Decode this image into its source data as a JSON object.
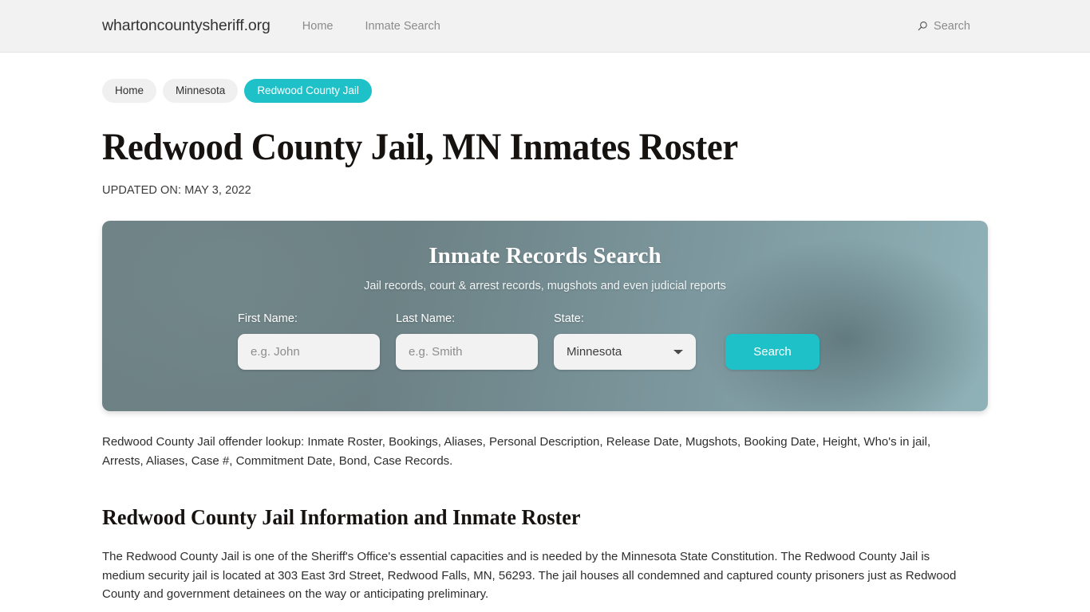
{
  "header": {
    "brand": "whartoncountysheriff.org",
    "nav": [
      {
        "label": "Home"
      },
      {
        "label": "Inmate Search"
      }
    ],
    "search": {
      "icon": "search-icon",
      "label": "Search"
    }
  },
  "breadcrumb": [
    {
      "label": "Home",
      "current": false
    },
    {
      "label": "Minnesota",
      "current": false
    },
    {
      "label": "Redwood County Jail",
      "current": true
    }
  ],
  "main": {
    "page_title": "Redwood County Jail, MN Inmates Roster",
    "updated_on": "UPDATED ON: MAY 3, 2022",
    "lookup_text": "Redwood County Jail offender lookup: Inmate Roster, Bookings, Aliases, Personal Description, Release Date, Mugshots, Booking Date, Height, Who's in jail, Arrests, Aliases, Case #, Commitment Date, Bond, Case Records.",
    "section_title": "Redwood County Jail Information and Inmate Roster",
    "section_body": "The Redwood County Jail is one of the Sheriff's Office's essential capacities and is needed by the Minnesota State Constitution. The Redwood County Jail is medium security jail is located at 303 East 3rd Street, Redwood Falls, MN, 56293. The jail houses all condemned and captured county prisoners just as Redwood County and government detainees on the way or anticipating preliminary."
  },
  "search_panel": {
    "title": "Inmate Records Search",
    "subtitle": "Jail records, court & arrest records, mugshots and even judicial reports",
    "first_name": {
      "label": "First Name:",
      "placeholder": "e.g. John",
      "value": ""
    },
    "last_name": {
      "label": "Last Name:",
      "placeholder": "e.g. Smith",
      "value": ""
    },
    "state": {
      "label": "State:",
      "selected": "Minnesota",
      "options": [
        "Minnesota"
      ]
    },
    "submit_label": "Search"
  },
  "colors": {
    "accent_teal": "#1fc1c9",
    "panel_left": "#6d8185",
    "panel_right": "#8fb2b8",
    "header_bg": "#f2f2f2",
    "pill_bg": "#f0f0f0",
    "input_bg": "#f2f2f2"
  }
}
